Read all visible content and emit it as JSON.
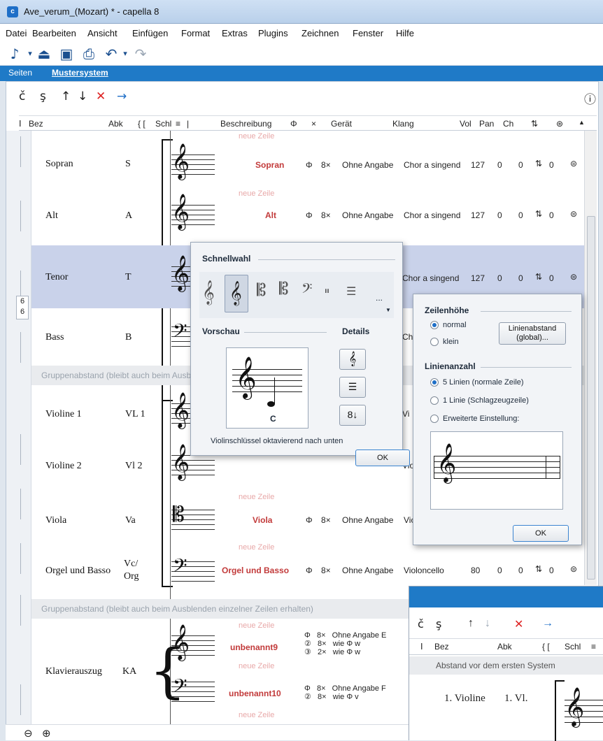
{
  "window": {
    "title": "Ave_verum_(Mozart) * - capella 8",
    "app_icon": "capella-icon"
  },
  "menu": [
    "Datei",
    "Bearbeiten",
    "Ansicht",
    "Einfügen",
    "Format",
    "Extras",
    "Plugins",
    "Zeichnen",
    "Fenster",
    "Hilfe"
  ],
  "tabs": {
    "seiten": "Seiten",
    "mustersystem": "Mustersystem"
  },
  "columns": {
    "bez": "Bez",
    "abk": "Abk",
    "brackets": "{  [",
    "schl": "Schl",
    "eq": "≡",
    "bar": "|",
    "beschreibung": "Beschreibung",
    "ch_symbol": "Φ",
    "x": "×",
    "geraet": "Gerät",
    "klang": "Klang",
    "vol": "Vol",
    "pan": "Pan",
    "ch": "Ch"
  },
  "new_row": "neue Zeile",
  "rows": [
    {
      "name": "Sopran",
      "abk": "S",
      "desc": "Sopran",
      "phi": "Φ",
      "mult": "8×",
      "geraet": "Ohne Angabe",
      "klang": "Chor a singend",
      "vol": "127",
      "pan": "0",
      "ch": "0",
      "t": "0"
    },
    {
      "name": "Alt",
      "abk": "A",
      "desc": "Alt",
      "phi": "Φ",
      "mult": "8×",
      "geraet": "Ohne Angabe",
      "klang": "Chor a singend",
      "vol": "127",
      "pan": "0",
      "ch": "0",
      "t": "0"
    },
    {
      "name": "Tenor",
      "abk": "T",
      "klang": "Chor a singend",
      "vol": "127",
      "pan": "0",
      "ch": "0",
      "t": "0",
      "badge_top": "6",
      "badge_bottom": "6"
    },
    {
      "name": "Bass",
      "abk": "B",
      "klang_partial": "Ch"
    },
    {
      "name": "Violine 1",
      "abk": "VL 1",
      "klang_partial": "Vi"
    },
    {
      "name": "Violine 2",
      "abk": "Vl 2",
      "klang_partial": "Vio"
    },
    {
      "name": "Viola",
      "abk": "Va",
      "desc": "Viola",
      "phi": "Φ",
      "mult": "8×",
      "geraet": "Ohne Angabe",
      "klang_partial": "Vic"
    },
    {
      "name": "Orgel und Basso",
      "abk1": "Vc/",
      "abk2": "Org",
      "desc": "Orgel und Basso",
      "phi": "Φ",
      "mult": "8×",
      "geraet": "Ohne Angabe",
      "klang": "Violoncello",
      "vol": "80",
      "pan": "0",
      "ch": "0",
      "t": "0"
    }
  ],
  "gap1": "Gruppenabstand (bleibt auch beim Ausbl",
  "gap2": "Gruppenabstand (bleibt auch beim Ausblenden einzelner Zeilen erhalten)",
  "piano": {
    "name": "Klavierauszug",
    "abk": "KA",
    "desc1": "unbenannt9",
    "desc2": "unbenannt10",
    "lines1": [
      [
        "Φ",
        "8×",
        "Ohne Angabe",
        "E"
      ],
      [
        "②",
        "8×",
        "wie Φ",
        "w"
      ],
      [
        "③",
        "2×",
        "wie Φ",
        "w"
      ]
    ],
    "lines2": [
      [
        "Φ",
        "8×",
        "Ohne Angabe",
        "F"
      ],
      [
        "②",
        "8×",
        "wie Φ",
        "v"
      ]
    ]
  },
  "clef_dialog": {
    "title": "Schnellwahl",
    "preview": "Vorschau",
    "details": "Details",
    "note_label": "C",
    "caption": "Violinschlüssel oktavierend nach unten",
    "ok": "OK",
    "more": "..."
  },
  "line_dialog": {
    "title_height": "Zeilenhöhe",
    "normal": "normal",
    "klein": "klein",
    "spacing_btn1": "Linienabstand",
    "spacing_btn2": "(global)...",
    "title_lines": "Linienanzahl",
    "opt5": "5 Linien (normale Zeile)",
    "opt1": "1 Linie (Schlagzeugzeile)",
    "optx": "Erweiterte Einstellung:",
    "ok": "OK"
  },
  "inset": {
    "header": {
      "bez": "Bez",
      "abk": "Abk",
      "brackets": "{  [",
      "schl": "Schl",
      "eq": "≡"
    },
    "band": "Abstand vor dem ersten System",
    "row_name": "1. Violine",
    "row_abk": "1. Vl."
  }
}
